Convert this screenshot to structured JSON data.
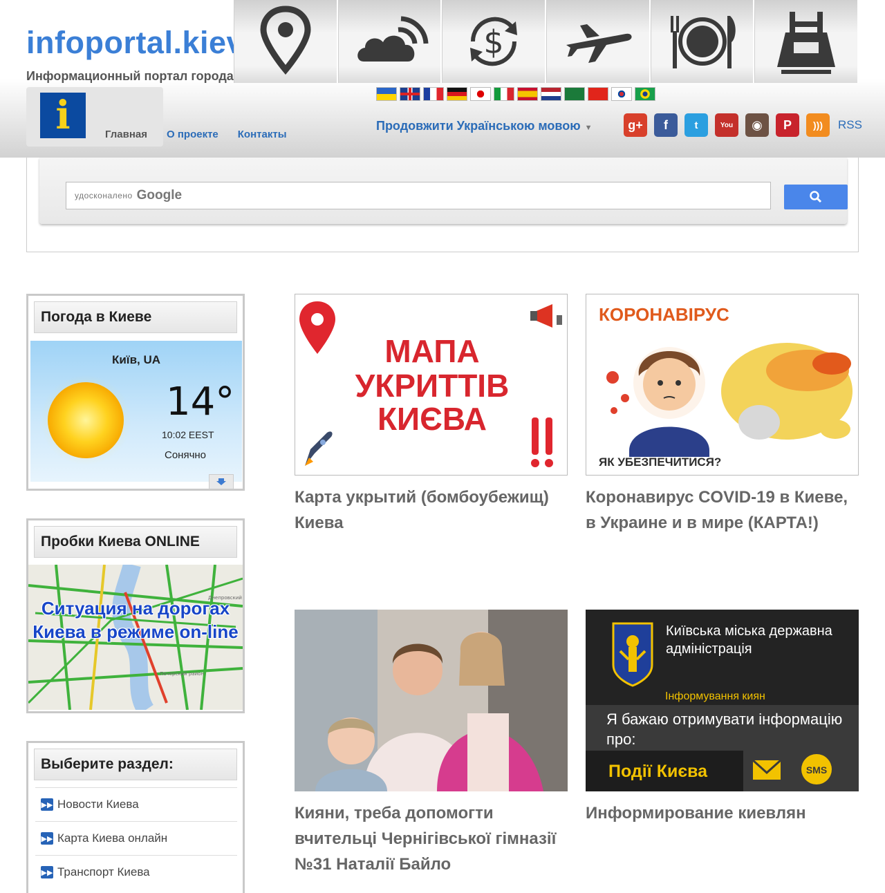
{
  "header": {
    "site_title": "infoportal.kiev.ua",
    "site_subtitle": "Информационный портал города Киева",
    "icon_strip": [
      "map-pin-icon",
      "weather-icon",
      "currency-exchange-icon",
      "airplane-icon",
      "restaurant-icon",
      "metro-icon"
    ],
    "nav": {
      "home": "Главная",
      "about": "О проекте",
      "contacts": "Контакты"
    },
    "flags": [
      "ukraine",
      "united-kingdom",
      "france",
      "germany",
      "japan",
      "italy",
      "spain",
      "netherlands",
      "saudi-arabia",
      "china",
      "south-korea",
      "brazil"
    ],
    "language_select": "Продовжити Українською мовою",
    "social": [
      "google-plus",
      "facebook",
      "twitter",
      "youtube",
      "instagram",
      "pinterest",
      "rss"
    ],
    "rss_label": "RSS"
  },
  "search": {
    "placeholder_small": "удосконалено",
    "placeholder_brand": "Google"
  },
  "sidebar": {
    "weather": {
      "title": "Погода в Киеве",
      "city": "Київ, UA",
      "temperature": "14°",
      "time": "10:02 EEST",
      "condition": "Сонячно"
    },
    "traffic": {
      "title": "Пробки Киева ONLINE",
      "banner_text": "Ситуация на дорогах Киева в режиме on-line",
      "map_labels": [
        "Днепровский район",
        "Печерский район"
      ]
    },
    "sections": {
      "title": "Выберите раздел:",
      "items": [
        "Новости Киева",
        "Карта Киева онлайн",
        "Транспорт Киева"
      ]
    }
  },
  "articles": [
    {
      "image_lines": [
        "МАПА",
        "УКРИТТІВ",
        "КИЄВА"
      ],
      "title": "Карта укрытий (бомбоубежищ) Киева"
    },
    {
      "image_top": "КОРОНАВІРУС",
      "image_bottom": "ЯК УБЕЗПЕЧИТИСЯ?",
      "title": "Коронавирус COVID-19 в Киеве, в Украине и в мире (КАРТА!)"
    },
    {
      "title": "Кияни, треба допомогти вчительці Чернігівської гімназії №31 Наталії Байло"
    },
    {
      "image_org": "Київська міська державна адміністрація",
      "image_sub": "Інформування киян",
      "image_text": "Я бажаю отримувати інформацію про:",
      "image_button": "Події Києва",
      "image_sms": "SMS",
      "title": "Информирование киевлян"
    }
  ],
  "colors": {
    "brand_blue": "#3b7fd6",
    "link_blue": "#2b6cb8",
    "search_button": "#4a86ea",
    "red_text": "#d8262e"
  }
}
